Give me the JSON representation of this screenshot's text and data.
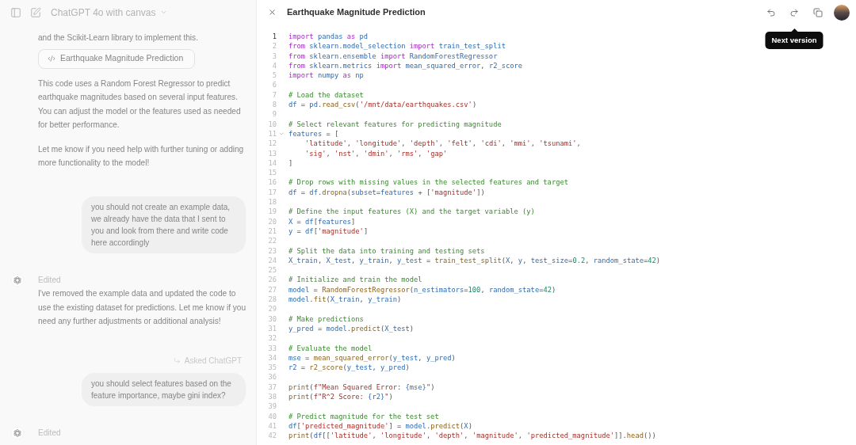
{
  "header": {
    "title": "ChatGPT 4o with canvas"
  },
  "chat": {
    "items": [
      {
        "kind": "text",
        "text": "and the Scikit-Learn library to implement this."
      },
      {
        "kind": "canvas_link",
        "text": "Earthquake Magnitude Prediction"
      },
      {
        "kind": "text",
        "text": "This code uses a Random Forest Regressor to predict earthquake magnitudes based on several input features. You can adjust the model or the features used as needed for better performance."
      },
      {
        "kind": "text",
        "text": "Let me know if you need help with further tuning or adding more functionality to the model!"
      },
      {
        "kind": "user",
        "text": "you should not create an example data, we already have the data that I sent to you and look from there and write code here accordingly"
      },
      {
        "kind": "assistant",
        "status": "Edited",
        "text": "I've removed the example data and updated the code to use the existing dataset for predictions. Let me know if you need any further adjustments or additional analysis!"
      },
      {
        "kind": "reply_context",
        "text": "Asked ChatGPT"
      },
      {
        "kind": "user",
        "text": "you should select features based on the feature importance, maybe gini index?"
      },
      {
        "kind": "assistant",
        "status": "Edited"
      }
    ]
  },
  "canvas": {
    "title": "Earthquake Magnitude Prediction",
    "tooltip": "Next version",
    "code_lines": [
      {
        "number": "1",
        "active": true,
        "fold": false,
        "tokens": [
          {
            "kind": "keyword",
            "text": "import"
          },
          {
            "kind": "name",
            "text": " pandas "
          },
          {
            "kind": "keyword",
            "text": "as"
          },
          {
            "kind": "name",
            "text": " pd"
          }
        ]
      },
      {
        "number": "2",
        "active": false,
        "fold": false,
        "tokens": [
          {
            "kind": "keyword",
            "text": "from"
          },
          {
            "kind": "name",
            "text": " sklearn.model_selection "
          },
          {
            "kind": "keyword",
            "text": "import"
          },
          {
            "kind": "name",
            "text": " train_test_split"
          }
        ]
      },
      {
        "number": "3",
        "active": false,
        "fold": false,
        "tokens": [
          {
            "kind": "keyword",
            "text": "from"
          },
          {
            "kind": "name",
            "text": " sklearn.ensemble "
          },
          {
            "kind": "keyword",
            "text": "import"
          },
          {
            "kind": "name",
            "text": " RandomForestRegressor"
          }
        ]
      },
      {
        "number": "4",
        "active": false,
        "fold": false,
        "tokens": [
          {
            "kind": "keyword",
            "text": "from"
          },
          {
            "kind": "name",
            "text": " sklearn.metrics "
          },
          {
            "kind": "keyword",
            "text": "import"
          },
          {
            "kind": "name",
            "text": " mean_squared_error"
          },
          {
            "kind": "plain",
            "text": ", "
          },
          {
            "kind": "name",
            "text": "r2_score"
          }
        ]
      },
      {
        "number": "5",
        "active": false,
        "fold": false,
        "tokens": [
          {
            "kind": "keyword",
            "text": "import"
          },
          {
            "kind": "name",
            "text": " numpy "
          },
          {
            "kind": "keyword",
            "text": "as"
          },
          {
            "kind": "name",
            "text": " np"
          }
        ]
      },
      {
        "number": "6",
        "active": false,
        "fold": false
      },
      {
        "number": "7",
        "active": false,
        "fold": false,
        "tokens": [
          {
            "kind": "comment",
            "text": "# Load the dataset"
          }
        ]
      },
      {
        "number": "8",
        "active": false,
        "fold": false,
        "tokens": [
          {
            "kind": "name",
            "text": "df"
          },
          {
            "kind": "plain",
            "text": " = "
          },
          {
            "kind": "name",
            "text": "pd"
          },
          {
            "kind": "plain",
            "text": "."
          },
          {
            "kind": "func",
            "text": "read_csv"
          },
          {
            "kind": "plain",
            "text": "("
          },
          {
            "kind": "string",
            "text": "'/mnt/data/earthquakes.csv'"
          },
          {
            "kind": "plain",
            "text": ")"
          }
        ]
      },
      {
        "number": "9",
        "active": false,
        "fold": false
      },
      {
        "number": "10",
        "active": false,
        "fold": false,
        "tokens": [
          {
            "kind": "comment",
            "text": "# Select relevant features for predicting magnitude"
          }
        ]
      },
      {
        "number": "11",
        "active": false,
        "fold": true,
        "tokens": [
          {
            "kind": "name",
            "text": "features"
          },
          {
            "kind": "plain",
            "text": " = ["
          }
        ]
      },
      {
        "number": "12",
        "active": false,
        "fold": false,
        "tokens": [
          {
            "kind": "string",
            "text": "    'latitude'"
          },
          {
            "kind": "plain",
            "text": ", "
          },
          {
            "kind": "string",
            "text": "'longitude'"
          },
          {
            "kind": "plain",
            "text": ", "
          },
          {
            "kind": "string",
            "text": "'depth'"
          },
          {
            "kind": "plain",
            "text": ", "
          },
          {
            "kind": "string",
            "text": "'felt'"
          },
          {
            "kind": "plain",
            "text": ", "
          },
          {
            "kind": "string",
            "text": "'cdi'"
          },
          {
            "kind": "plain",
            "text": ", "
          },
          {
            "kind": "string",
            "text": "'mmi'"
          },
          {
            "kind": "plain",
            "text": ", "
          },
          {
            "kind": "string",
            "text": "'tsunami'"
          },
          {
            "kind": "plain",
            "text": ","
          }
        ]
      },
      {
        "number": "13",
        "active": false,
        "fold": false,
        "tokens": [
          {
            "kind": "string",
            "text": "    'sig'"
          },
          {
            "kind": "plain",
            "text": ", "
          },
          {
            "kind": "string",
            "text": "'nst'"
          },
          {
            "kind": "plain",
            "text": ", "
          },
          {
            "kind": "string",
            "text": "'dmin'"
          },
          {
            "kind": "plain",
            "text": ", "
          },
          {
            "kind": "string",
            "text": "'rms'"
          },
          {
            "kind": "plain",
            "text": ", "
          },
          {
            "kind": "string",
            "text": "'gap'"
          }
        ]
      },
      {
        "number": "14",
        "active": false,
        "fold": false,
        "tokens": [
          {
            "kind": "plain",
            "text": "]"
          }
        ]
      },
      {
        "number": "15",
        "active": false,
        "fold": false
      },
      {
        "number": "16",
        "active": false,
        "fold": false,
        "tokens": [
          {
            "kind": "comment",
            "text": "# Drop rows with missing values in the selected features and target"
          }
        ]
      },
      {
        "number": "17",
        "active": false,
        "fold": false,
        "tokens": [
          {
            "kind": "name",
            "text": "df"
          },
          {
            "kind": "plain",
            "text": " = "
          },
          {
            "kind": "name",
            "text": "df"
          },
          {
            "kind": "plain",
            "text": "."
          },
          {
            "kind": "func",
            "text": "dropna"
          },
          {
            "kind": "plain",
            "text": "("
          },
          {
            "kind": "name",
            "text": "subset"
          },
          {
            "kind": "plain",
            "text": "="
          },
          {
            "kind": "name",
            "text": "features"
          },
          {
            "kind": "plain",
            "text": " + ["
          },
          {
            "kind": "string",
            "text": "'magnitude'"
          },
          {
            "kind": "plain",
            "text": "])"
          }
        ]
      },
      {
        "number": "18",
        "active": false,
        "fold": false
      },
      {
        "number": "19",
        "active": false,
        "fold": false,
        "tokens": [
          {
            "kind": "comment",
            "text": "# Define the input features (X) and the target variable (y)"
          }
        ]
      },
      {
        "number": "20",
        "active": false,
        "fold": false,
        "tokens": [
          {
            "kind": "name",
            "text": "X"
          },
          {
            "kind": "plain",
            "text": " = "
          },
          {
            "kind": "name",
            "text": "df"
          },
          {
            "kind": "plain",
            "text": "["
          },
          {
            "kind": "name",
            "text": "features"
          },
          {
            "kind": "plain",
            "text": "]"
          }
        ]
      },
      {
        "number": "21",
        "active": false,
        "fold": false,
        "tokens": [
          {
            "kind": "name",
            "text": "y"
          },
          {
            "kind": "plain",
            "text": " = "
          },
          {
            "kind": "name",
            "text": "df"
          },
          {
            "kind": "plain",
            "text": "["
          },
          {
            "kind": "string",
            "text": "'magnitude'"
          },
          {
            "kind": "plain",
            "text": "]"
          }
        ]
      },
      {
        "number": "22",
        "active": false,
        "fold": false
      },
      {
        "number": "23",
        "active": false,
        "fold": false,
        "tokens": [
          {
            "kind": "comment",
            "text": "# Split the data into training and testing sets"
          }
        ]
      },
      {
        "number": "24",
        "active": false,
        "fold": false,
        "tokens": [
          {
            "kind": "name",
            "text": "X_train"
          },
          {
            "kind": "plain",
            "text": ", "
          },
          {
            "kind": "name",
            "text": "X_test"
          },
          {
            "kind": "plain",
            "text": ", "
          },
          {
            "kind": "name",
            "text": "y_train"
          },
          {
            "kind": "plain",
            "text": ", "
          },
          {
            "kind": "name",
            "text": "y_test"
          },
          {
            "kind": "plain",
            "text": " = "
          },
          {
            "kind": "func",
            "text": "train_test_split"
          },
          {
            "kind": "plain",
            "text": "("
          },
          {
            "kind": "name",
            "text": "X"
          },
          {
            "kind": "plain",
            "text": ", "
          },
          {
            "kind": "name",
            "text": "y"
          },
          {
            "kind": "plain",
            "text": ", "
          },
          {
            "kind": "name",
            "text": "test_size"
          },
          {
            "kind": "plain",
            "text": "="
          },
          {
            "kind": "number",
            "text": "0.2"
          },
          {
            "kind": "plain",
            "text": ", "
          },
          {
            "kind": "name",
            "text": "random_state"
          },
          {
            "kind": "plain",
            "text": "="
          },
          {
            "kind": "number",
            "text": "42"
          },
          {
            "kind": "plain",
            "text": ")"
          }
        ]
      },
      {
        "number": "25",
        "active": false,
        "fold": false
      },
      {
        "number": "26",
        "active": false,
        "fold": false,
        "tokens": [
          {
            "kind": "comment",
            "text": "# Initialize and train the model"
          }
        ]
      },
      {
        "number": "27",
        "active": false,
        "fold": false,
        "tokens": [
          {
            "kind": "name",
            "text": "model"
          },
          {
            "kind": "plain",
            "text": " = "
          },
          {
            "kind": "func",
            "text": "RandomForestRegressor"
          },
          {
            "kind": "plain",
            "text": "("
          },
          {
            "kind": "name",
            "text": "n_estimators"
          },
          {
            "kind": "plain",
            "text": "="
          },
          {
            "kind": "number",
            "text": "100"
          },
          {
            "kind": "plain",
            "text": ", "
          },
          {
            "kind": "name",
            "text": "random_state"
          },
          {
            "kind": "plain",
            "text": "="
          },
          {
            "kind": "number",
            "text": "42"
          },
          {
            "kind": "plain",
            "text": ")"
          }
        ]
      },
      {
        "number": "28",
        "active": false,
        "fold": false,
        "tokens": [
          {
            "kind": "name",
            "text": "model"
          },
          {
            "kind": "plain",
            "text": "."
          },
          {
            "kind": "func",
            "text": "fit"
          },
          {
            "kind": "plain",
            "text": "("
          },
          {
            "kind": "name",
            "text": "X_train"
          },
          {
            "kind": "plain",
            "text": ", "
          },
          {
            "kind": "name",
            "text": "y_train"
          },
          {
            "kind": "plain",
            "text": ")"
          }
        ]
      },
      {
        "number": "29",
        "active": false,
        "fold": false
      },
      {
        "number": "30",
        "active": false,
        "fold": false,
        "tokens": [
          {
            "kind": "comment",
            "text": "# Make predictions"
          }
        ]
      },
      {
        "number": "31",
        "active": false,
        "fold": false,
        "tokens": [
          {
            "kind": "name",
            "text": "y_pred"
          },
          {
            "kind": "plain",
            "text": " = "
          },
          {
            "kind": "name",
            "text": "model"
          },
          {
            "kind": "plain",
            "text": "."
          },
          {
            "kind": "func",
            "text": "predict"
          },
          {
            "kind": "plain",
            "text": "("
          },
          {
            "kind": "name",
            "text": "X_test"
          },
          {
            "kind": "plain",
            "text": ")"
          }
        ]
      },
      {
        "number": "32",
        "active": false,
        "fold": false
      },
      {
        "number": "33",
        "active": false,
        "fold": false,
        "tokens": [
          {
            "kind": "comment",
            "text": "# Evaluate the model"
          }
        ]
      },
      {
        "number": "34",
        "active": false,
        "fold": false,
        "tokens": [
          {
            "kind": "name",
            "text": "mse"
          },
          {
            "kind": "plain",
            "text": " = "
          },
          {
            "kind": "func",
            "text": "mean_squared_error"
          },
          {
            "kind": "plain",
            "text": "("
          },
          {
            "kind": "name",
            "text": "y_test"
          },
          {
            "kind": "plain",
            "text": ", "
          },
          {
            "kind": "name",
            "text": "y_pred"
          },
          {
            "kind": "plain",
            "text": ")"
          }
        ]
      },
      {
        "number": "35",
        "active": false,
        "fold": false,
        "tokens": [
          {
            "kind": "name",
            "text": "r2"
          },
          {
            "kind": "plain",
            "text": " = "
          },
          {
            "kind": "func",
            "text": "r2_score"
          },
          {
            "kind": "plain",
            "text": "("
          },
          {
            "kind": "name",
            "text": "y_test"
          },
          {
            "kind": "plain",
            "text": ", "
          },
          {
            "kind": "name",
            "text": "y_pred"
          },
          {
            "kind": "plain",
            "text": ")"
          }
        ]
      },
      {
        "number": "36",
        "active": false,
        "fold": false
      },
      {
        "number": "37",
        "active": false,
        "fold": false,
        "tokens": [
          {
            "kind": "func",
            "text": "print"
          },
          {
            "kind": "plain",
            "text": "("
          },
          {
            "kind": "string",
            "text": "f\"Mean Squared Error: "
          },
          {
            "kind": "name",
            "text": "{mse}"
          },
          {
            "kind": "string",
            "text": "\""
          },
          {
            "kind": "plain",
            "text": ")"
          }
        ]
      },
      {
        "number": "38",
        "active": false,
        "fold": false,
        "tokens": [
          {
            "kind": "func",
            "text": "print"
          },
          {
            "kind": "plain",
            "text": "("
          },
          {
            "kind": "string",
            "text": "f\"R^2 Score: "
          },
          {
            "kind": "name",
            "text": "{r2}"
          },
          {
            "kind": "string",
            "text": "\""
          },
          {
            "kind": "plain",
            "text": ")"
          }
        ]
      },
      {
        "number": "39",
        "active": false,
        "fold": false
      },
      {
        "number": "40",
        "active": false,
        "fold": false,
        "tokens": [
          {
            "kind": "comment",
            "text": "# Predict magnitude for the test set"
          }
        ]
      },
      {
        "number": "41",
        "active": false,
        "fold": false,
        "tokens": [
          {
            "kind": "name",
            "text": "df"
          },
          {
            "kind": "plain",
            "text": "["
          },
          {
            "kind": "string",
            "text": "'predicted_magnitude'"
          },
          {
            "kind": "plain",
            "text": "] = "
          },
          {
            "kind": "name",
            "text": "model"
          },
          {
            "kind": "plain",
            "text": "."
          },
          {
            "kind": "func",
            "text": "predict"
          },
          {
            "kind": "plain",
            "text": "("
          },
          {
            "kind": "name",
            "text": "X"
          },
          {
            "kind": "plain",
            "text": ")"
          }
        ]
      },
      {
        "number": "42",
        "active": false,
        "fold": false,
        "tokens": [
          {
            "kind": "func",
            "text": "print"
          },
          {
            "kind": "plain",
            "text": "("
          },
          {
            "kind": "name",
            "text": "df"
          },
          {
            "kind": "plain",
            "text": "[["
          },
          {
            "kind": "string",
            "text": "'latitude'"
          },
          {
            "kind": "plain",
            "text": ", "
          },
          {
            "kind": "string",
            "text": "'longitude'"
          },
          {
            "kind": "plain",
            "text": ", "
          },
          {
            "kind": "string",
            "text": "'depth'"
          },
          {
            "kind": "plain",
            "text": ", "
          },
          {
            "kind": "string",
            "text": "'magnitude'"
          },
          {
            "kind": "plain",
            "text": ", "
          },
          {
            "kind": "string",
            "text": "'predicted_magnitude'"
          },
          {
            "kind": "plain",
            "text": "]]."
          },
          {
            "kind": "func",
            "text": "head"
          },
          {
            "kind": "plain",
            "text": "())"
          }
        ]
      }
    ]
  }
}
